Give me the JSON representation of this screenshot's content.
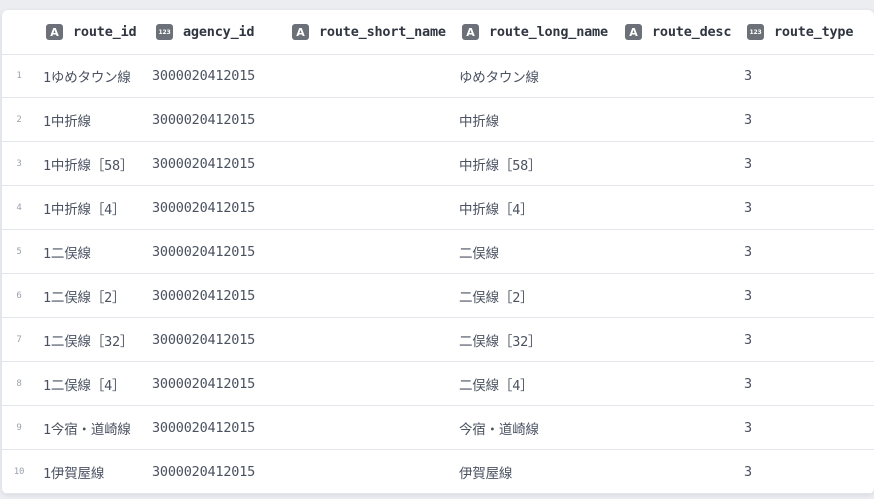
{
  "columns": [
    {
      "label": "route_id",
      "type_icon": "A",
      "type": "text"
    },
    {
      "label": "agency_id",
      "type_icon": "123",
      "type": "number"
    },
    {
      "label": "route_short_name",
      "type_icon": "A",
      "type": "text"
    },
    {
      "label": "route_long_name",
      "type_icon": "A",
      "type": "text"
    },
    {
      "label": "route_desc",
      "type_icon": "A",
      "type": "text"
    },
    {
      "label": "route_type",
      "type_icon": "123",
      "type": "number"
    }
  ],
  "rows": [
    {
      "n": "1",
      "route_id": "1ゆめタウン線",
      "agency_id": "3000020412015",
      "route_short_name": "",
      "route_long_name": "ゆめタウン線",
      "route_desc": "",
      "route_type": "3"
    },
    {
      "n": "2",
      "route_id": "1中折線",
      "agency_id": "3000020412015",
      "route_short_name": "",
      "route_long_name": "中折線",
      "route_desc": "",
      "route_type": "3"
    },
    {
      "n": "3",
      "route_id": "1中折線［58］",
      "agency_id": "3000020412015",
      "route_short_name": "",
      "route_long_name": "中折線［58］",
      "route_desc": "",
      "route_type": "3"
    },
    {
      "n": "4",
      "route_id": "1中折線［4］",
      "agency_id": "3000020412015",
      "route_short_name": "",
      "route_long_name": "中折線［4］",
      "route_desc": "",
      "route_type": "3"
    },
    {
      "n": "5",
      "route_id": "1二俣線",
      "agency_id": "3000020412015",
      "route_short_name": "",
      "route_long_name": "二俣線",
      "route_desc": "",
      "route_type": "3"
    },
    {
      "n": "6",
      "route_id": "1二俣線［2］",
      "agency_id": "3000020412015",
      "route_short_name": "",
      "route_long_name": "二俣線［2］",
      "route_desc": "",
      "route_type": "3"
    },
    {
      "n": "7",
      "route_id": "1二俣線［32］",
      "agency_id": "3000020412015",
      "route_short_name": "",
      "route_long_name": "二俣線［32］",
      "route_desc": "",
      "route_type": "3"
    },
    {
      "n": "8",
      "route_id": "1二俣線［4］",
      "agency_id": "3000020412015",
      "route_short_name": "",
      "route_long_name": "二俣線［4］",
      "route_desc": "",
      "route_type": "3"
    },
    {
      "n": "9",
      "route_id": "1今宿・道崎線",
      "agency_id": "3000020412015",
      "route_short_name": "",
      "route_long_name": "今宿・道崎線",
      "route_desc": "",
      "route_type": "3"
    },
    {
      "n": "10",
      "route_id": "1伊賀屋線",
      "agency_id": "3000020412015",
      "route_short_name": "",
      "route_long_name": "伊賀屋線",
      "route_desc": "",
      "route_type": "3"
    }
  ]
}
